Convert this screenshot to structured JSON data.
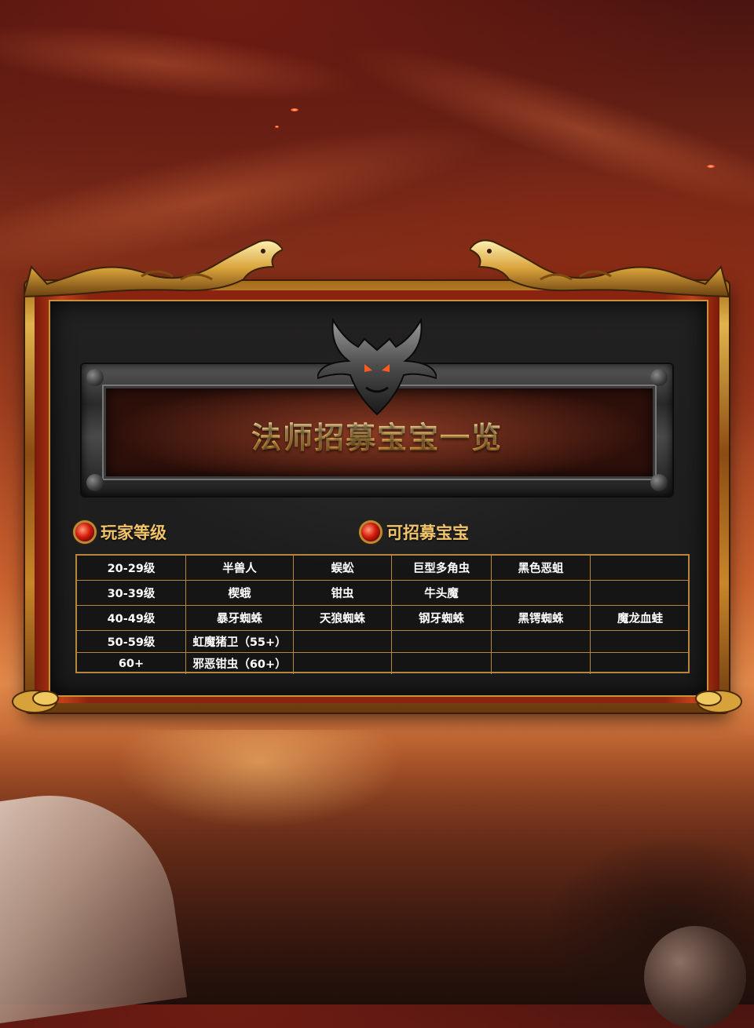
{
  "title": "法师招募宝宝一览",
  "headers": {
    "level": "玩家等级",
    "pets": "可招募宝宝"
  },
  "rows": [
    {
      "level": "20-29级",
      "pets": [
        "半兽人",
        "蜈蚣",
        "巨型多角虫",
        "黑色恶蛆",
        ""
      ]
    },
    {
      "level": "30-39级",
      "pets": [
        "楔蛾",
        "钳虫",
        "牛头魔",
        "",
        ""
      ]
    },
    {
      "level": "40-49级",
      "pets": [
        "暴牙蜘蛛",
        "天狼蜘蛛",
        "钢牙蜘蛛",
        "黑锷蜘蛛",
        "魔龙血蛙"
      ]
    },
    {
      "level": "50-59级",
      "pets": [
        "虹魔猪卫（55+）",
        "",
        "",
        "",
        ""
      ]
    },
    {
      "level": "60+",
      "pets": [
        "邪恶钳虫（60+）",
        "",
        "",
        "",
        ""
      ]
    }
  ],
  "colors": {
    "gold": "#c8923a",
    "title_gold": "#ffd88a",
    "panel": "#1b1b1b",
    "gem_red": "#d41a0a"
  },
  "icons": [
    "dragon-left-icon",
    "dragon-right-icon",
    "demon-crest-icon",
    "red-gem-icon"
  ]
}
